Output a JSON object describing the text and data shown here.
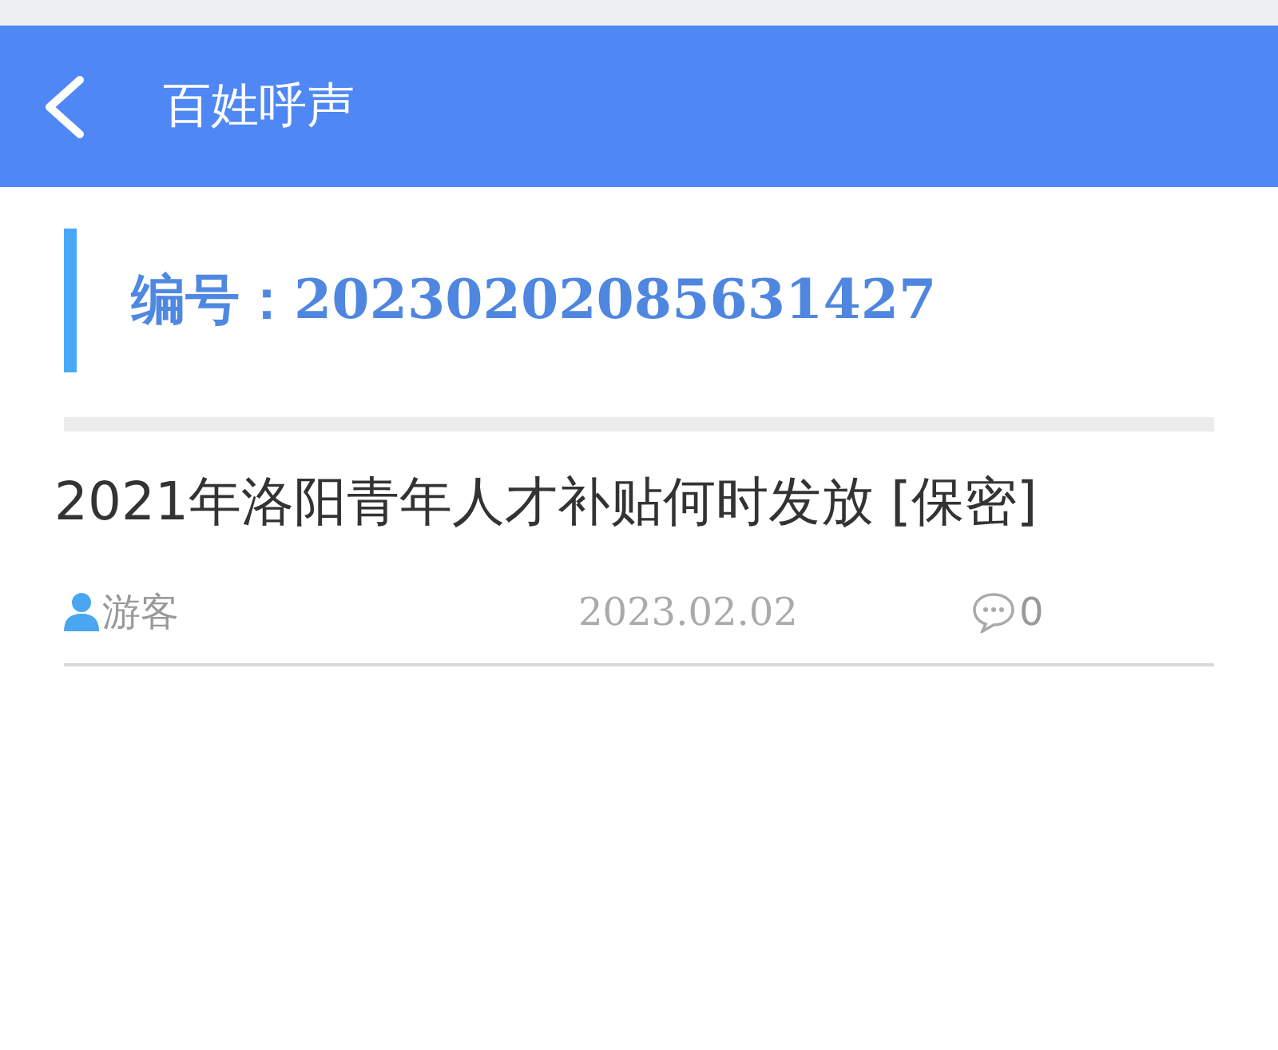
{
  "header": {
    "title": "百姓呼声"
  },
  "record": {
    "label": "编号：",
    "number": "20230202085631427"
  },
  "post": {
    "title": "2021年洛阳青年人才补贴何时发放 [保密]",
    "author": "游客",
    "date": "2023.02.02",
    "comments": "0"
  }
}
